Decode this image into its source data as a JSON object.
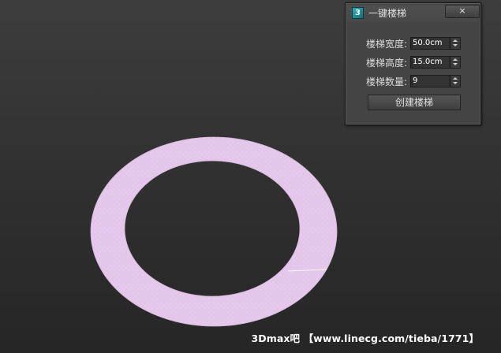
{
  "dialog": {
    "title": "一键楼梯",
    "app_icon_glyph": "3",
    "close_glyph": "×",
    "fields": [
      {
        "label": "楼梯宽度:",
        "value": "50.0cm"
      },
      {
        "label": "楼梯高度:",
        "value": "15.0cm"
      },
      {
        "label": "楼梯数量:",
        "value": "9"
      }
    ],
    "create_button": "创建楼梯"
  },
  "viewport": {
    "ring_fill": "#e3c6e9",
    "background": "#333333"
  },
  "watermark": "3Dmax吧 【www.linecg.com/tieba/1771】",
  "icons": [
    "app-icon",
    "close-icon",
    "spinner-up-icon",
    "spinner-down-icon"
  ]
}
